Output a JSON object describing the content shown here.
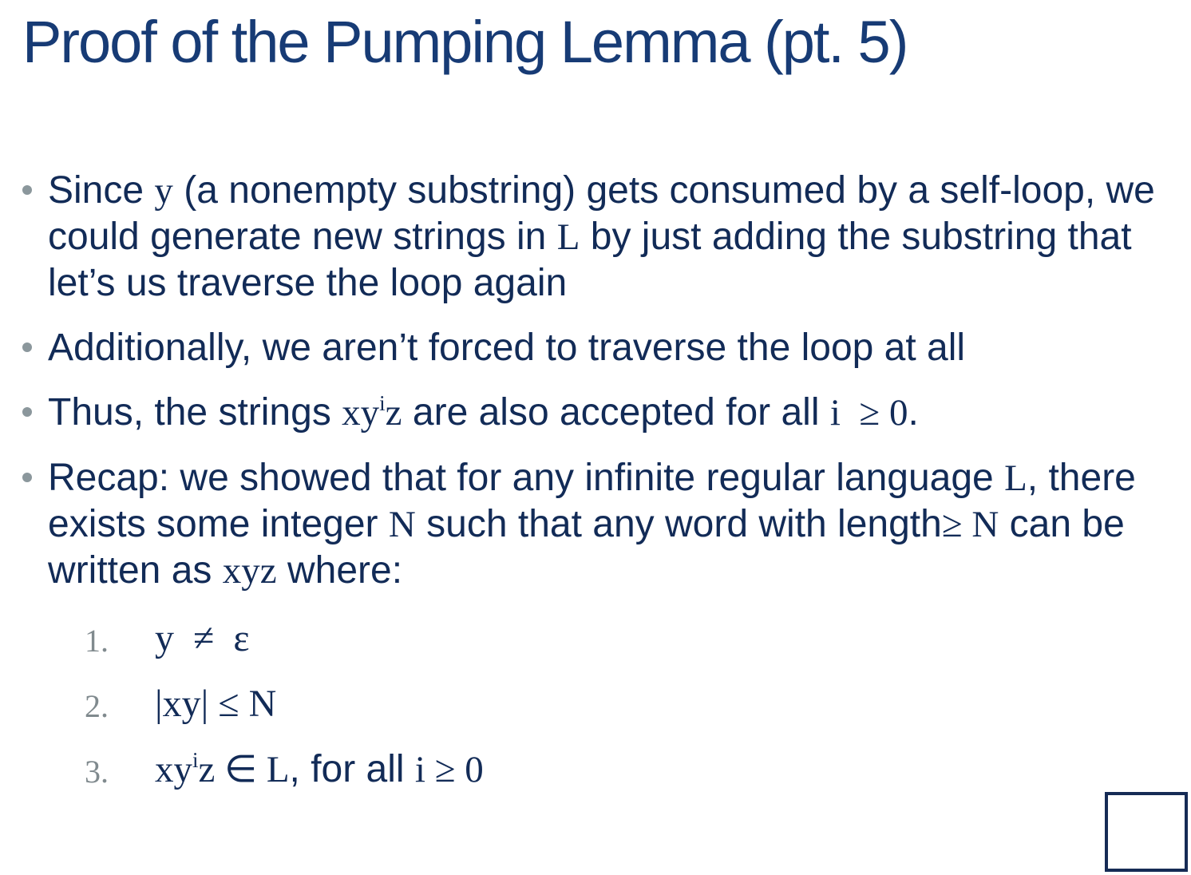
{
  "slide": {
    "title": "Proof of the Pumping Lemma (pt. 5)",
    "bullets": [
      {
        "t1": "Since ",
        "m1": "y",
        "t2": " (a nonempty substring) gets consumed by a self-loop, we could generate new strings in ",
        "m2": "L",
        "t3": " by just adding the substring that let’s us traverse the loop again"
      },
      {
        "t1": "Additionally, we aren’t forced to traverse the loop at all"
      },
      {
        "t1": "Thus, the strings ",
        "m1": "xy",
        "m1_sup": "i",
        "m1_tail": "z",
        "t2": " are also accepted for all ",
        "m2": "i  ≥ 0",
        "t3": "."
      },
      {
        "t1": "Recap: we showed that for any infinite regular language ",
        "m1": "L",
        "t2": ", there exists some integer ",
        "m2": "N",
        "t3": " such that any word with length",
        "m3": "≥ N",
        "t4": " can be written as ",
        "m4": "xyz",
        "t5": " where:"
      }
    ],
    "conditions": [
      {
        "label": "1.",
        "math": "y  ≠  ε"
      },
      {
        "label": "2.",
        "math": "|xy| ≤ N"
      },
      {
        "label": "3.",
        "math_a": "xy",
        "math_sup": "i",
        "math_b": "z ∈ L",
        "text": ", for all ",
        "math_c": "i ≥ 0"
      }
    ]
  }
}
